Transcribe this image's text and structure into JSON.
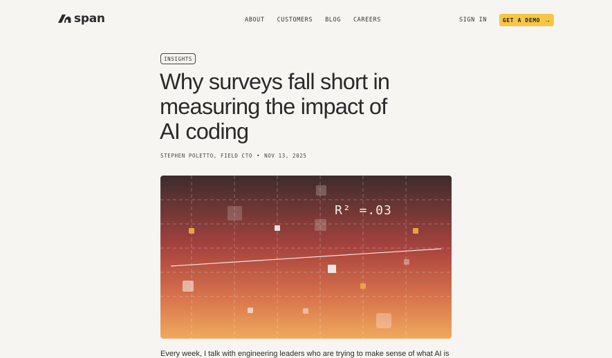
{
  "brand": {
    "name": "span"
  },
  "nav": {
    "links": [
      "ABOUT",
      "CUSTOMERS",
      "BLOG",
      "CAREERS"
    ],
    "sign_in": "SIGN IN",
    "cta": {
      "label": "GET A DEMO",
      "icon": "arrow-right-icon",
      "color": "#f6c645"
    }
  },
  "article": {
    "tag": "INSIGHTS",
    "title": "Why surveys fall short in measuring the impact of AI coding",
    "author": "STEPHEN POLETTO, FIELD CTO",
    "separator": "•",
    "date": "NOV 13, 2025",
    "hero": {
      "annotation": "R² =.03",
      "gradient": [
        "#3d2b2c",
        "#a9443f",
        "#f0a95e"
      ]
    },
    "body_preview": "Every week, I talk with engineering leaders who are trying to make sense of what AI is"
  }
}
